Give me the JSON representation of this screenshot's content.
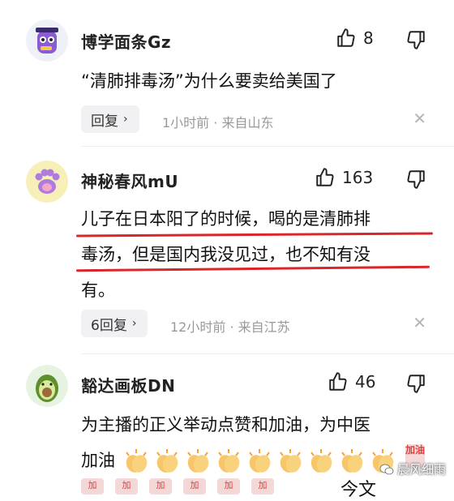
{
  "comments": [
    {
      "username": "博学面条Gz",
      "likes": "8",
      "text": "“清肺排毒汤”为什么要卖给美国了",
      "reply_label": "回复",
      "meta": "1小时前 · 来自山东",
      "avatar_icon": "purple-character-avatar"
    },
    {
      "username": "神秘春风mU",
      "likes": "163",
      "text_lines": [
        "儿子在日本阳了的时候，喝的是清肺排",
        "毒汤，但是国内我没见过，也不知有没",
        "有。"
      ],
      "reply_label": "6回复",
      "meta": "12小时前 · 来自江苏",
      "avatar_icon": "cat-paw-avatar"
    },
    {
      "username": "豁达画板DN",
      "likes": "46",
      "text_lines": [
        "为主播的正义举动点赞和加油，为中医",
        "加油"
      ],
      "avatar_icon": "avocado-avatar"
    }
  ],
  "tags": [
    "加油",
    "加",
    "加",
    "加",
    "加",
    "加",
    "加"
  ],
  "partial_text": "今文",
  "watermark": "晨风细雨",
  "colors": {
    "underline": "#d9262b",
    "accent_tag": "#e04040",
    "reply_bg": "#f1f1f3"
  }
}
